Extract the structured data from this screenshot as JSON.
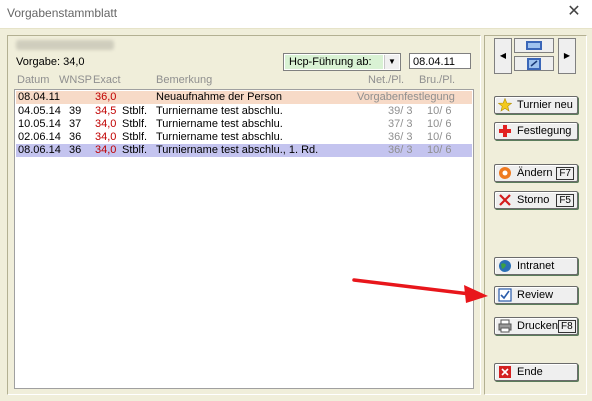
{
  "window": {
    "title": "Vorgabenstammblatt",
    "close_glyph": "✕"
  },
  "header": {
    "vorgabe": "Vorgabe: 34,0",
    "hcp_select": "Hcp-Führung ab:",
    "date": "08.04.11"
  },
  "columns": [
    "Datum",
    "WNSP",
    "Exact",
    "Bemerkung",
    "Net./Pl.",
    "Bru./Pl."
  ],
  "rows": [
    {
      "datum": "08.04.11",
      "wnsp": "",
      "exact": "36,0",
      "typ": "",
      "bemerkung": "Neuaufnahme der Person",
      "net": "Vorgabenfestlegung",
      "bru": "",
      "state": "highlight"
    },
    {
      "datum": "04.05.14",
      "wnsp": "39",
      "exact": "34,5",
      "typ": "Stblf.",
      "bemerkung": "Turniername test abschlu.",
      "net": "39/ 3",
      "bru": "10/ 6",
      "state": "normal"
    },
    {
      "datum": "10.05.14",
      "wnsp": "37",
      "exact": "34,0",
      "typ": "Stblf.",
      "bemerkung": "Turniername test abschlu.",
      "net": "37/ 3",
      "bru": "10/ 6",
      "state": "normal"
    },
    {
      "datum": "02.06.14",
      "wnsp": "36",
      "exact": "34,0",
      "typ": "Stblf.",
      "bemerkung": "Turniername test abschlu.",
      "net": "36/ 3",
      "bru": "10/ 6",
      "state": "normal"
    },
    {
      "datum": "08.06.14",
      "wnsp": "36",
      "exact": "34,0",
      "typ": "Stblf.",
      "bemerkung": "Turniername test abschlu., 1. Rd.",
      "net": "36/ 3",
      "bru": "10/ 6",
      "state": "selected"
    }
  ],
  "buttons": {
    "turnier_neu": "Turnier neu",
    "festlegung": "Festlegung",
    "aendern": "Ändern",
    "aendern_key": "F7",
    "storno": "Storno",
    "storno_key": "F5",
    "intranet": "Intranet",
    "review": "Review",
    "drucken": "Drucken",
    "drucken_key": "F8",
    "ende": "Ende"
  },
  "colors": {
    "accent_red": "#e8161b",
    "selected_row": "#c4c4ef",
    "highlight_row": "#f7dac7",
    "hcp_bg": "#d9f2d4"
  },
  "icons": [
    "close-icon",
    "nav-left-icon",
    "nav-right-icon",
    "nav-up-icon",
    "nav-down-icon",
    "star-icon",
    "plus-icon",
    "ring-icon",
    "x-icon",
    "globe-icon",
    "review-icon",
    "printer-icon",
    "exit-icon",
    "annotation-arrow"
  ]
}
